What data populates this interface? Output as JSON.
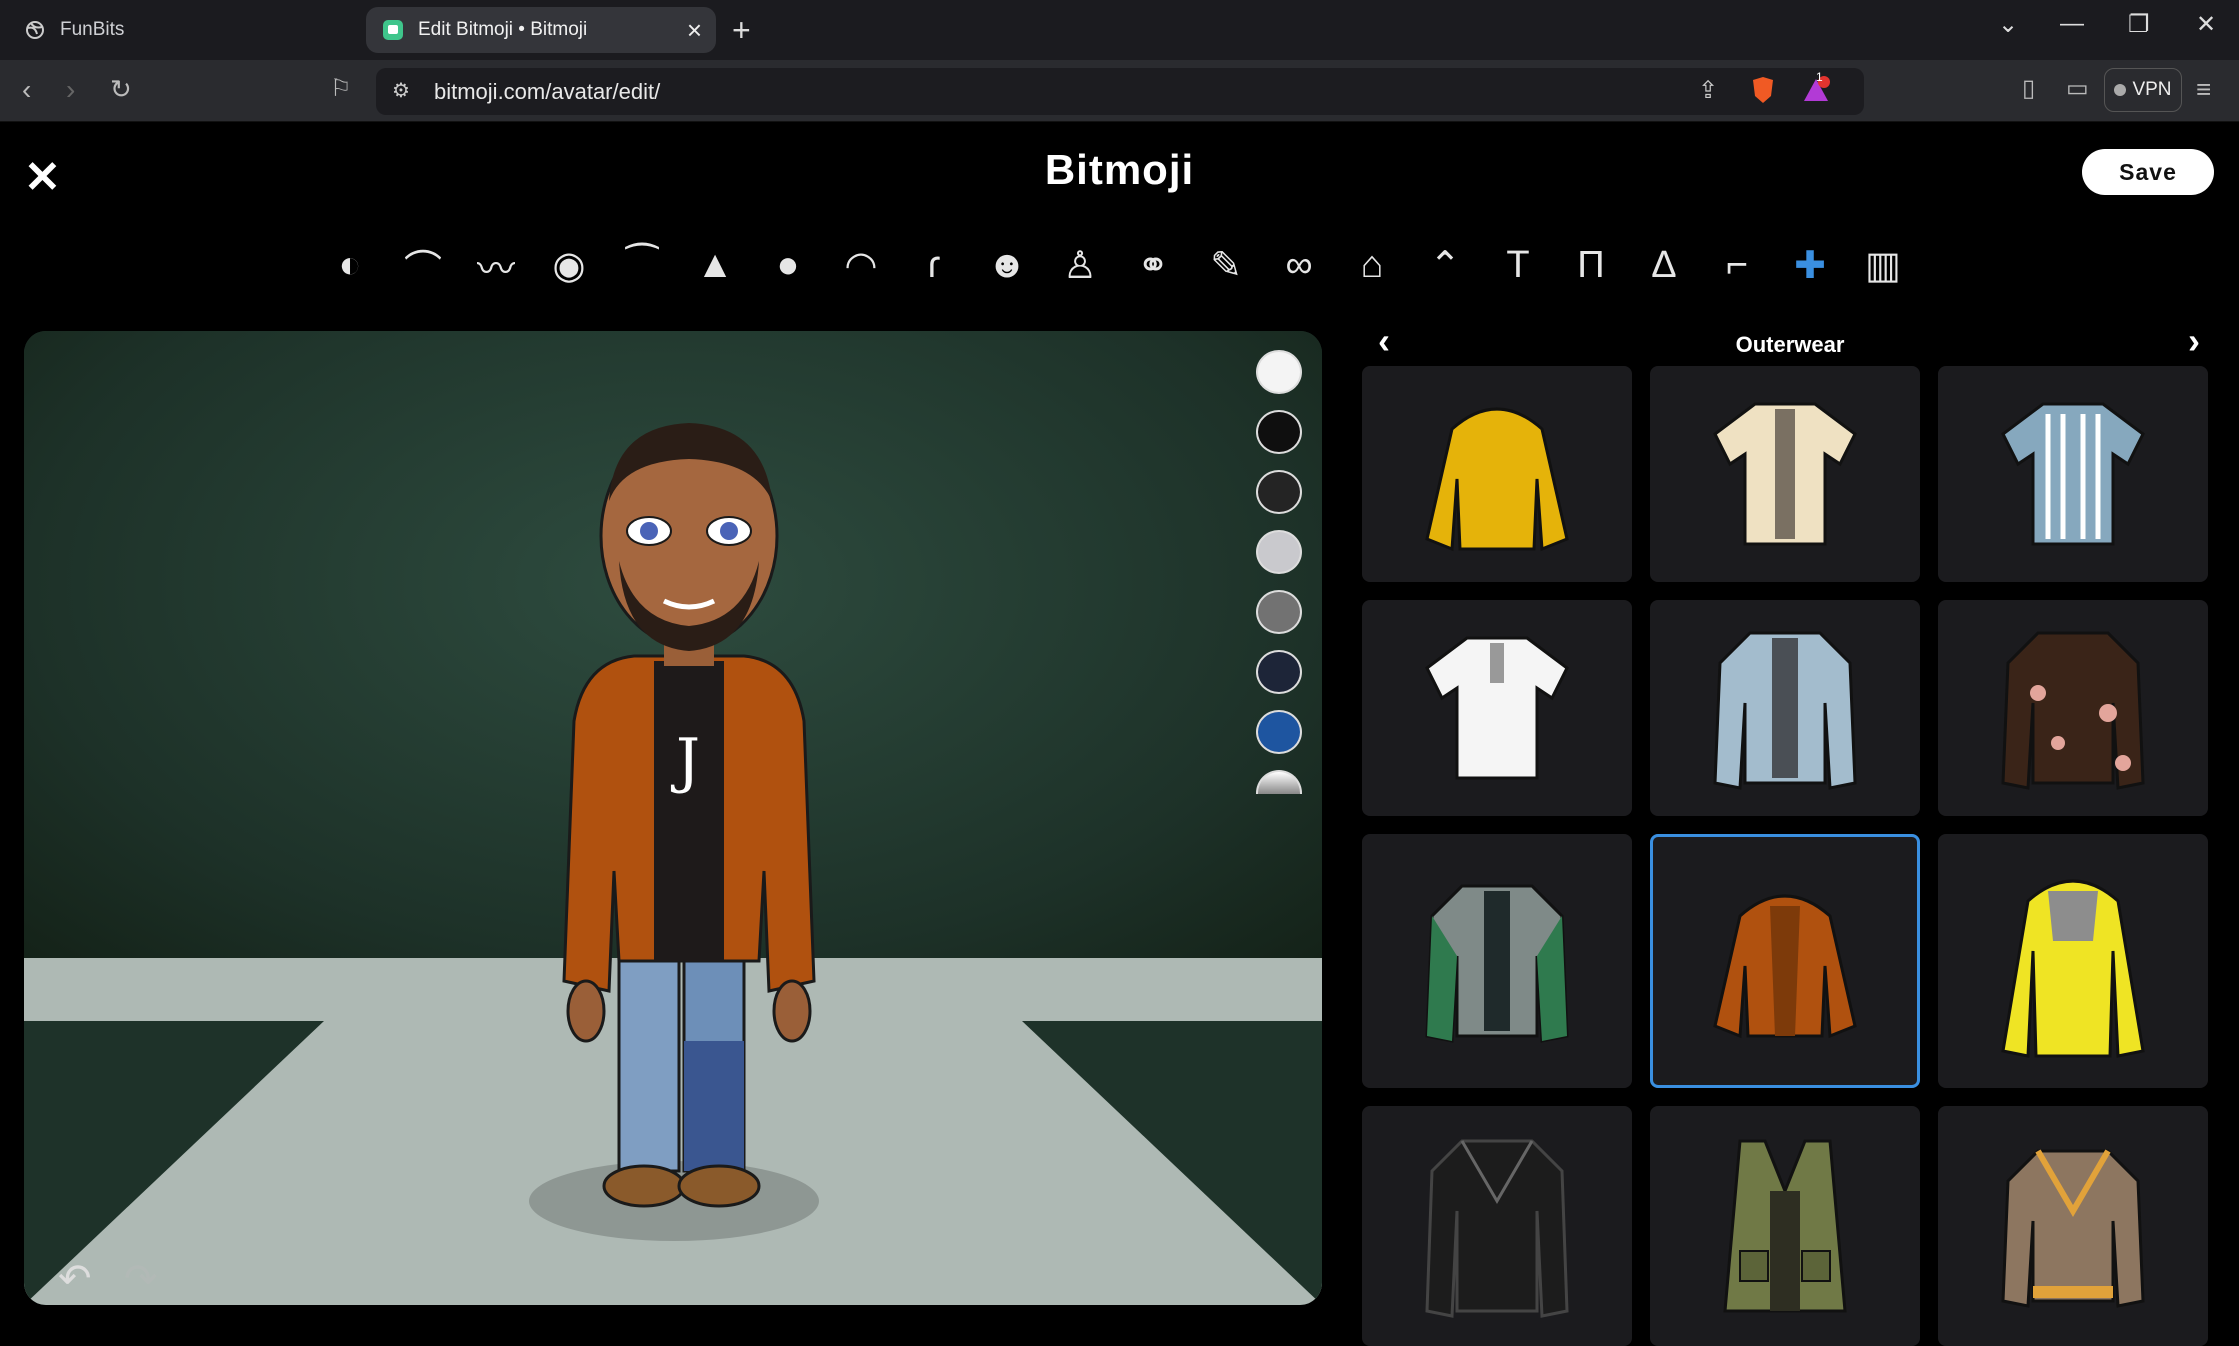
{
  "browser": {
    "tabs": [
      {
        "title": "FunBits"
      },
      {
        "title": "Edit Bitmoji • Bitmoji"
      }
    ],
    "url": "bitmoji.com/avatar/edit/",
    "vpn_label": "VPN",
    "badge_count": "1"
  },
  "app": {
    "title": "Bitmoji",
    "save_label": "Save"
  },
  "categories": [
    "face-shape",
    "hair",
    "facial-hair",
    "eyes",
    "eyebrows",
    "nose",
    "head",
    "mouth",
    "ear",
    "face-details",
    "body",
    "family",
    "makeup",
    "glasses",
    "hats",
    "outfits",
    "tops",
    "bottoms",
    "dresses",
    "footwear",
    "outerwear",
    "wardrobe"
  ],
  "active_category": "outerwear",
  "panel": {
    "title": "Outerwear",
    "items": [
      {
        "name": "yellow hoodie",
        "color": "#e5b30a"
      },
      {
        "name": "cream shirt",
        "color": "#efe1c2"
      },
      {
        "name": "striped shirt",
        "color": "#86a8be"
      },
      {
        "name": "white shirt",
        "color": "#f5f5f5"
      },
      {
        "name": "denim jacket",
        "color": "#a3bccd"
      },
      {
        "name": "floral jacket",
        "color": "#3a2418"
      },
      {
        "name": "varsity jacket",
        "color": "#2c3b35"
      },
      {
        "name": "orange hoodie",
        "color": "#b0510f"
      },
      {
        "name": "yellow raincoat",
        "color": "#efe424"
      },
      {
        "name": "leather jacket",
        "color": "#1c1c1c"
      },
      {
        "name": "utility vest",
        "color": "#707946"
      },
      {
        "name": "cardigan",
        "color": "#8d7660"
      }
    ],
    "selected": "orange hoodie"
  },
  "swatches": [
    "#f4f4f4",
    "#0f0f0f",
    "#242424",
    "#c9c9cd",
    "#727272",
    "#1d2538",
    "#1e55a0",
    "#9a9a9a"
  ]
}
